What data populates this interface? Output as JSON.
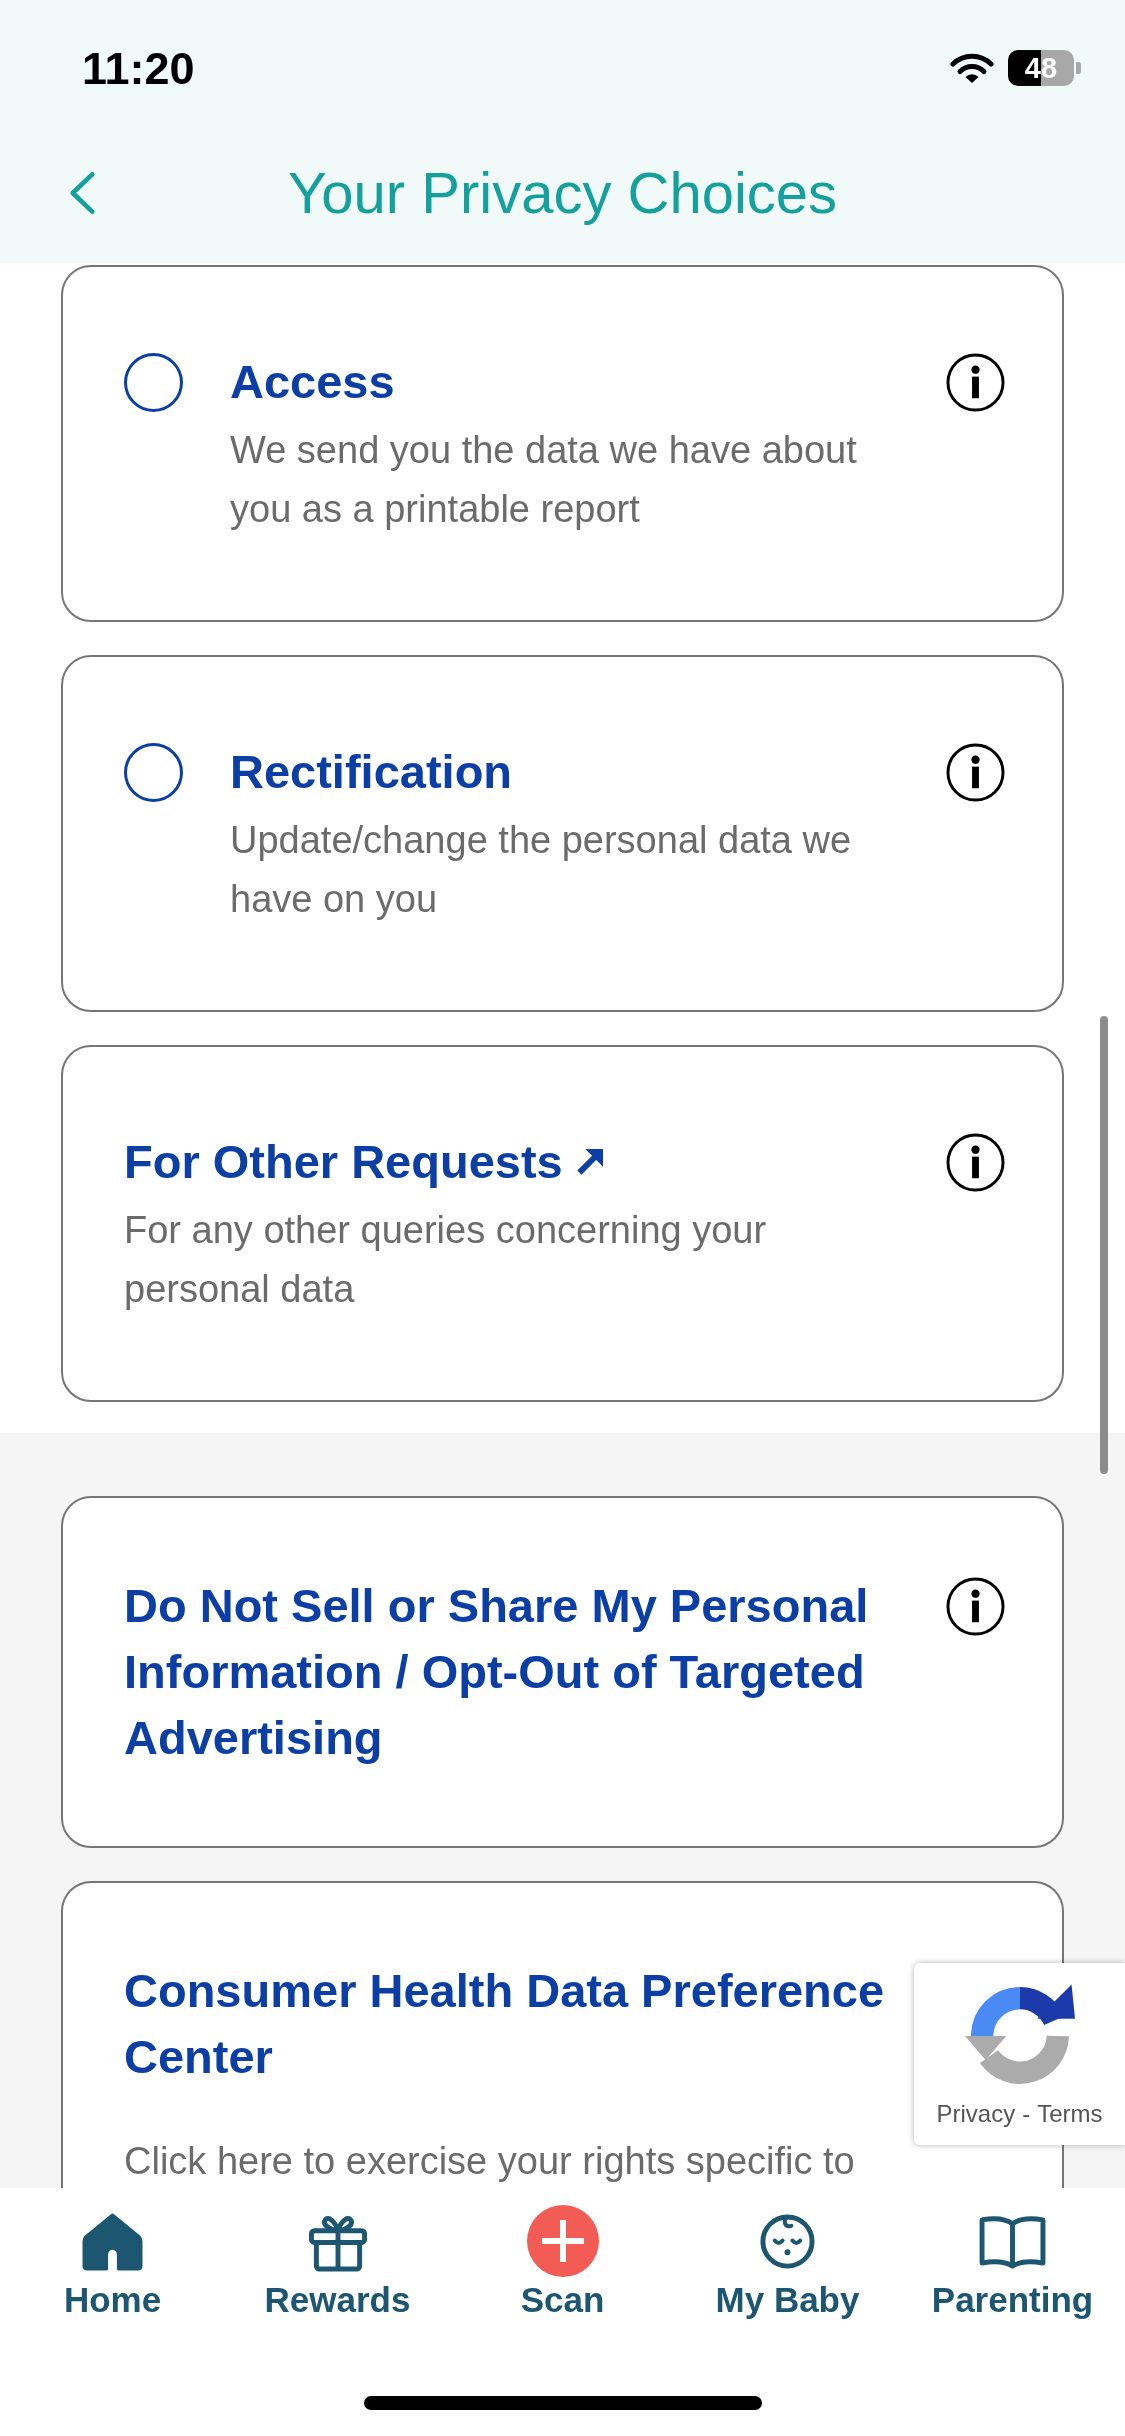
{
  "status_bar": {
    "time": "11:20",
    "battery": "48"
  },
  "header": {
    "title": "Your Privacy Choices"
  },
  "sections": [
    {
      "cards": [
        {
          "kind": "option",
          "title": "Access",
          "description": "We send you the data we have about you as a printable report",
          "selected": false,
          "info": true
        },
        {
          "kind": "option",
          "title": "Rectification",
          "description": "Update/change the personal data we have on you",
          "selected": false,
          "info": true
        },
        {
          "kind": "link",
          "title": "For Other Requests",
          "external": true,
          "description": "For any other queries concerning your personal data",
          "info": true
        }
      ]
    },
    {
      "cards": [
        {
          "kind": "link",
          "title": "Do Not Sell or Share My Personal Information / Opt-Out of Targeted Advertising",
          "external": false,
          "info": true
        },
        {
          "kind": "panel",
          "title": "Consumer Health Data Preference Center",
          "external": false,
          "description": "Click here to exercise your rights specific to",
          "info": false
        }
      ]
    }
  ],
  "recaptcha": {
    "links": [
      "Privacy",
      "Terms"
    ],
    "separator": "-"
  },
  "tab_bar": [
    {
      "label": "Home",
      "selected": true
    },
    {
      "label": "Rewards",
      "selected": false
    },
    {
      "label": "Scan",
      "selected": false
    },
    {
      "label": "My Baby",
      "selected": false
    },
    {
      "label": "Parenting",
      "selected": false
    }
  ]
}
